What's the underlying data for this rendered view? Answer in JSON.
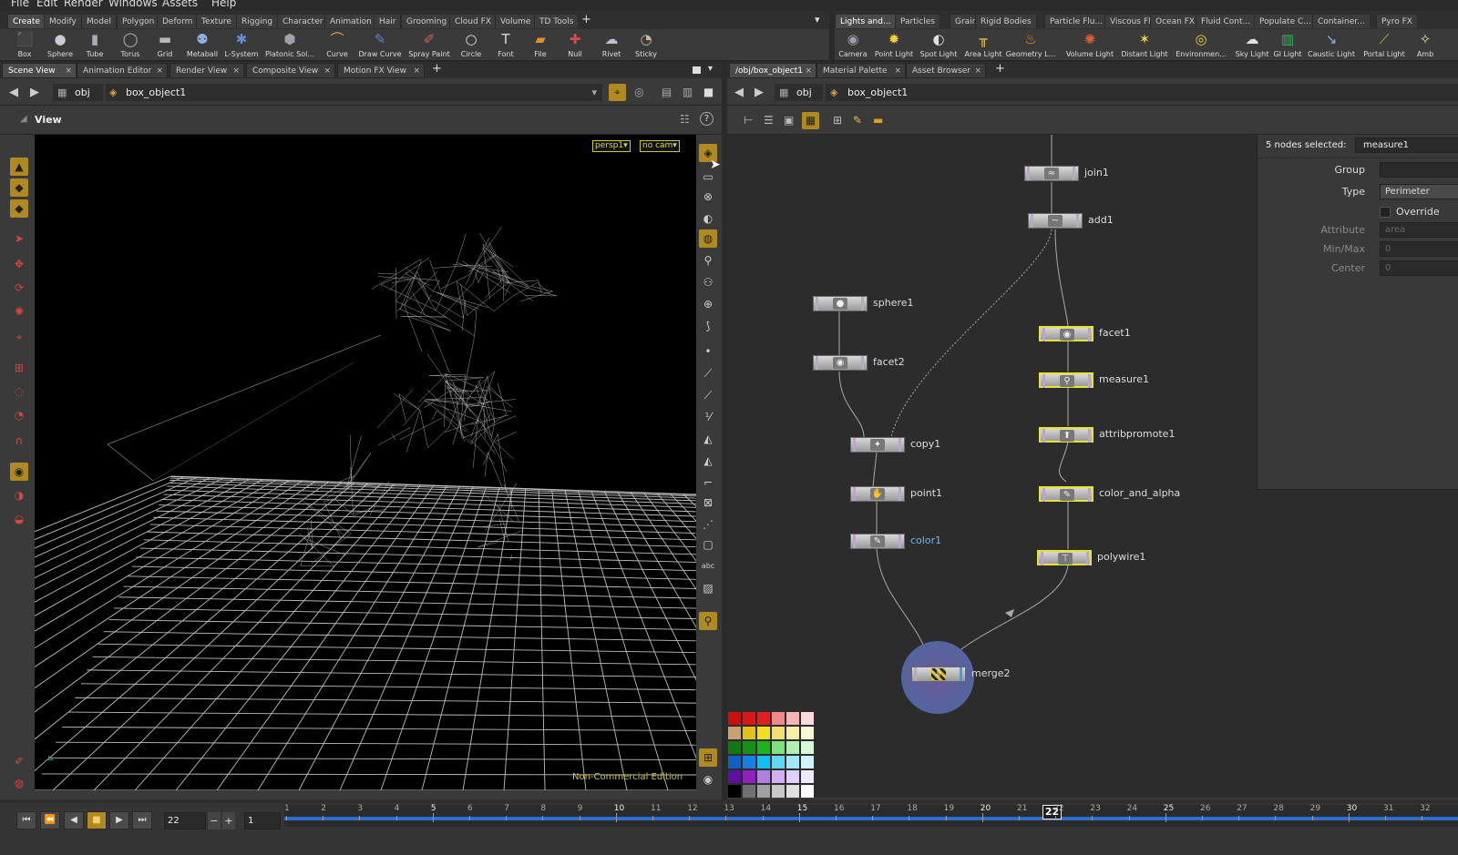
{
  "menu": [
    "File",
    "Edit",
    "Render",
    "Windows",
    "Assets",
    "Help"
  ],
  "shelf_left": {
    "tabs": [
      "Create",
      "Modify",
      "Model",
      "Polygon",
      "Deform",
      "Texture",
      "Rigging",
      "Character",
      "Animation",
      "Hair",
      "Grooming",
      "Cloud FX",
      "Volume",
      "TD Tools"
    ],
    "add_tab": "+",
    "tools": [
      {
        "label": "Box",
        "icon": "box-icon",
        "glyph": "⬛",
        "color": "#8a96a8"
      },
      {
        "label": "Sphere",
        "icon": "sphere-icon",
        "glyph": "●",
        "color": "#c8ccd4"
      },
      {
        "label": "Tube",
        "icon": "tube-icon",
        "glyph": "▮",
        "color": "#a8acb4"
      },
      {
        "label": "Torus",
        "icon": "torus-icon",
        "glyph": "◯",
        "color": "#b4b8c0"
      },
      {
        "label": "Grid",
        "icon": "grid-icon",
        "glyph": "▬",
        "color": "#b8b8b8"
      },
      {
        "label": "Metaball",
        "icon": "metaball-icon",
        "glyph": "⚉",
        "color": "#8fb0e0"
      },
      {
        "label": "L-System",
        "icon": "lsystem-icon",
        "glyph": "✱",
        "color": "#6a8ad8"
      },
      {
        "label": "Platonic Sol...",
        "icon": "platonic-icon",
        "glyph": "⬢",
        "color": "#a0a0a8"
      },
      {
        "label": "Curve",
        "icon": "curve-icon",
        "glyph": "⌒",
        "color": "#e0a050"
      },
      {
        "label": "Draw Curve",
        "icon": "draw-curve-icon",
        "glyph": "✎",
        "color": "#6080d0"
      },
      {
        "label": "Spray Paint",
        "icon": "spray-paint-icon",
        "glyph": "✐",
        "color": "#d06060"
      },
      {
        "label": "Circle",
        "icon": "circle-icon",
        "glyph": "○",
        "color": "#dddddd"
      },
      {
        "label": "Font",
        "icon": "font-icon",
        "glyph": "T",
        "color": "#dddddd"
      },
      {
        "label": "File",
        "icon": "file-icon",
        "glyph": "▰",
        "color": "#e09030"
      },
      {
        "label": "Null",
        "icon": "null-icon",
        "glyph": "✚",
        "color": "#d05050"
      },
      {
        "label": "Rivet",
        "icon": "rivet-icon",
        "glyph": "☁",
        "color": "#c0c0c8"
      },
      {
        "label": "Sticky",
        "icon": "sticky-icon",
        "glyph": "◔",
        "color": "#c8b8a0"
      }
    ],
    "dropdown_glyph": "▾"
  },
  "shelf_right": {
    "tabs": [
      "Lights and...",
      "Particles",
      "Grains",
      "Rigid Bodies",
      "Particle Flu...",
      "Viscous Fl...",
      "Ocean FX",
      "Fluid Cont...",
      "Populate C...",
      "Container...",
      "Pyro FX"
    ],
    "tools": [
      {
        "label": "Camera",
        "icon": "camera-icon",
        "glyph": "◉",
        "color": "#9aa0a8"
      },
      {
        "label": "Point Light",
        "icon": "point-light-icon",
        "glyph": "✹",
        "color": "#f0d040"
      },
      {
        "label": "Spot Light",
        "icon": "spot-light-icon",
        "glyph": "◐",
        "color": "#e0e0e0"
      },
      {
        "label": "Area Light",
        "icon": "area-light-icon",
        "glyph": "╥",
        "color": "#f0c040"
      },
      {
        "label": "Geometry L...",
        "icon": "geometry-light-icon",
        "glyph": "♨",
        "color": "#f09040"
      },
      {
        "label": "Volume Light",
        "icon": "volume-light-icon",
        "glyph": "✺",
        "color": "#e06030"
      },
      {
        "label": "Distant Light",
        "icon": "distant-light-icon",
        "glyph": "✶",
        "color": "#f0d040"
      },
      {
        "label": "Environmen...",
        "icon": "environment-light-icon",
        "glyph": "◎",
        "color": "#e0d030"
      },
      {
        "label": "Sky Light",
        "icon": "sky-light-icon",
        "glyph": "☁",
        "color": "#e0e0e0"
      },
      {
        "label": "GI Light",
        "icon": "gi-light-icon",
        "glyph": "▥",
        "color": "#40b060"
      },
      {
        "label": "Caustic Light",
        "icon": "caustic-light-icon",
        "glyph": "↘",
        "color": "#90b0e0"
      },
      {
        "label": "Portal Light",
        "icon": "portal-light-icon",
        "glyph": "⟋",
        "color": "#b0c040"
      },
      {
        "label": "Amb",
        "icon": "ambient-light-icon",
        "glyph": "✧",
        "color": "#e0e0a0"
      }
    ]
  },
  "left_pane": {
    "tabs": [
      "Scene View",
      "Animation Editor",
      "Render View",
      "Composite View",
      "Motion FX View"
    ],
    "close_glyph": "×",
    "add_tab": "+",
    "path": {
      "root": "obj",
      "object": "box_object1"
    },
    "view_title": "View",
    "camera_menu": "persp1▾",
    "cam_menu": "no cam▾",
    "watermark": "Non-Commercial Edition",
    "help_glyph": "?"
  },
  "right_pane": {
    "tabs": [
      "/obj/box_object1",
      "Material Palette",
      "Asset Browser"
    ],
    "close_glyph": "×",
    "add_tab": "+",
    "path": {
      "root": "obj",
      "object": "box_object1"
    }
  },
  "nodes": [
    {
      "name": "join1",
      "icon": "join-icon",
      "glyph": "≈",
      "selected": false
    },
    {
      "name": "add1",
      "icon": "add-icon",
      "glyph": "~",
      "selected": false
    },
    {
      "name": "sphere1",
      "icon": "sphere-node-icon",
      "glyph": "●",
      "selected": false
    },
    {
      "name": "facet2",
      "icon": "facet-icon",
      "glyph": "◉",
      "selected": false
    },
    {
      "name": "copy1",
      "icon": "copy-icon",
      "glyph": "✦",
      "selected": false
    },
    {
      "name": "point1",
      "icon": "point-icon",
      "glyph": "✋",
      "selected": false
    },
    {
      "name": "color1",
      "icon": "color-icon",
      "glyph": "✎",
      "selected": false,
      "label_color": "#6fb7e6"
    },
    {
      "name": "facet1",
      "icon": "facet-icon",
      "glyph": "◉",
      "selected": true
    },
    {
      "name": "measure1",
      "icon": "measure-icon",
      "glyph": "⚲",
      "selected": true
    },
    {
      "name": "attribpromote1",
      "icon": "attribpromote-icon",
      "glyph": "⬆",
      "selected": true
    },
    {
      "name": "color_and_alpha",
      "icon": "wrangle-icon",
      "glyph": "✎",
      "selected": true
    },
    {
      "name": "polywire1",
      "icon": "polywire-icon",
      "glyph": "⊤",
      "selected": true
    },
    {
      "name": "merge2",
      "icon": "merge-icon",
      "glyph": "⫴",
      "selected": false
    }
  ],
  "params": {
    "header": "5 nodes selected:",
    "node_name": "measure1",
    "rows": [
      {
        "label": "Group",
        "value": "",
        "enabled": true
      },
      {
        "label": "Type",
        "value": "Perimeter",
        "enabled": true
      },
      {
        "label": "",
        "value": "Override",
        "enabled": true,
        "checkbox": true
      },
      {
        "label": "Attribute",
        "value": "area",
        "enabled": false
      },
      {
        "label": "Min/Max",
        "value": "0",
        "enabled": false
      },
      {
        "label": "Center",
        "value": "0",
        "enabled": false
      }
    ]
  },
  "palette_colors": [
    [
      "#c81010",
      "#d81818",
      "#e02020",
      "#f08a8a",
      "#f4b4b4",
      "#f8dada"
    ],
    [
      "#c8a070",
      "#e0c020",
      "#f0e020",
      "#f0e070",
      "#f4f0a8",
      "#f8f8d8"
    ],
    [
      "#107810",
      "#189018",
      "#20b020",
      "#80e080",
      "#b0f0b0",
      "#d8f8d8"
    ],
    [
      "#1060c0",
      "#1880e0",
      "#10c0f0",
      "#60d8f0",
      "#a0e8f8",
      "#d0f4fc"
    ],
    [
      "#6010a0",
      "#9020c0",
      "#b080e0",
      "#d0b0f0",
      "#e0d0f8",
      "#f0e8fc"
    ],
    [
      "#000000",
      "#707070",
      "#a0a0a0",
      "#c8c8c8",
      "#e0e0e0",
      "#ffffff"
    ]
  ],
  "timeline": {
    "current_frame": "22",
    "step": "1",
    "start_frame": "1",
    "ticks": [
      "1",
      "2",
      "3",
      "4",
      "5",
      "6",
      "7",
      "8",
      "9",
      "10",
      "11",
      "12",
      "13",
      "14",
      "15",
      "16",
      "17",
      "18",
      "19",
      "20",
      "21",
      "22",
      "23",
      "24",
      "25",
      "26",
      "27",
      "28",
      "29",
      "30",
      "31",
      "32"
    ],
    "buttons": [
      {
        "name": "jump-start-button",
        "icon": "jump-start-icon",
        "glyph": "⏮"
      },
      {
        "name": "step-back-button",
        "icon": "step-back-icon",
        "glyph": "⏪"
      },
      {
        "name": "play-reverse-button",
        "icon": "play-reverse-icon",
        "glyph": "◀"
      },
      {
        "name": "stop-button",
        "icon": "stop-icon",
        "glyph": "■"
      },
      {
        "name": "play-button",
        "icon": "play-icon",
        "glyph": "▶"
      },
      {
        "name": "jump-end-button",
        "icon": "jump-end-icon",
        "glyph": "⏭"
      }
    ],
    "minus": "−",
    "plus": "+"
  },
  "colors": {
    "accent": "#e5e52f",
    "selected_node_border": "#e5e52f",
    "timeline_bar": "#2a6fd0",
    "toggle_on": "#b08a20"
  }
}
